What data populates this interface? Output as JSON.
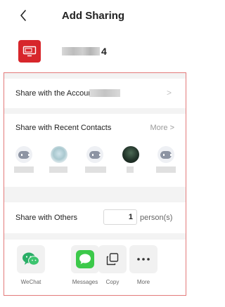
{
  "header": {
    "title": "Add Sharing",
    "back_icon": "chevron-left-icon"
  },
  "device": {
    "name_suffix": "4",
    "icon": "tv-icon",
    "icon_color": "#d7262b"
  },
  "share_account": {
    "label": "Share with the Account",
    "chevron": ">"
  },
  "recent_contacts": {
    "label": "Share with Recent Contacts",
    "more_label": "More >",
    "contacts": [
      {
        "avatar": "robot-avatar-icon"
      },
      {
        "avatar": "landscape-photo-avatar"
      },
      {
        "avatar": "robot-avatar-icon"
      },
      {
        "avatar": "dark-photo-avatar"
      },
      {
        "avatar": "robot-avatar-icon"
      }
    ]
  },
  "share_others": {
    "label": "Share with Others",
    "count_value": "1",
    "unit": "person(s)"
  },
  "apps": [
    {
      "label": "WeChat",
      "icon": "wechat-icon",
      "color": "#2aae67"
    },
    {
      "label": "Messages",
      "icon": "messages-icon",
      "color": "#3cc94a"
    },
    {
      "label": "Copy",
      "icon": "copy-icon",
      "color": "#333333"
    },
    {
      "label": "More",
      "icon": "more-icon",
      "color": "#333333"
    }
  ],
  "colors": {
    "accent": "#d7262b",
    "panel_border": "#e37a7a",
    "muted": "#9a9a9a",
    "background": "#f3f3f3"
  }
}
